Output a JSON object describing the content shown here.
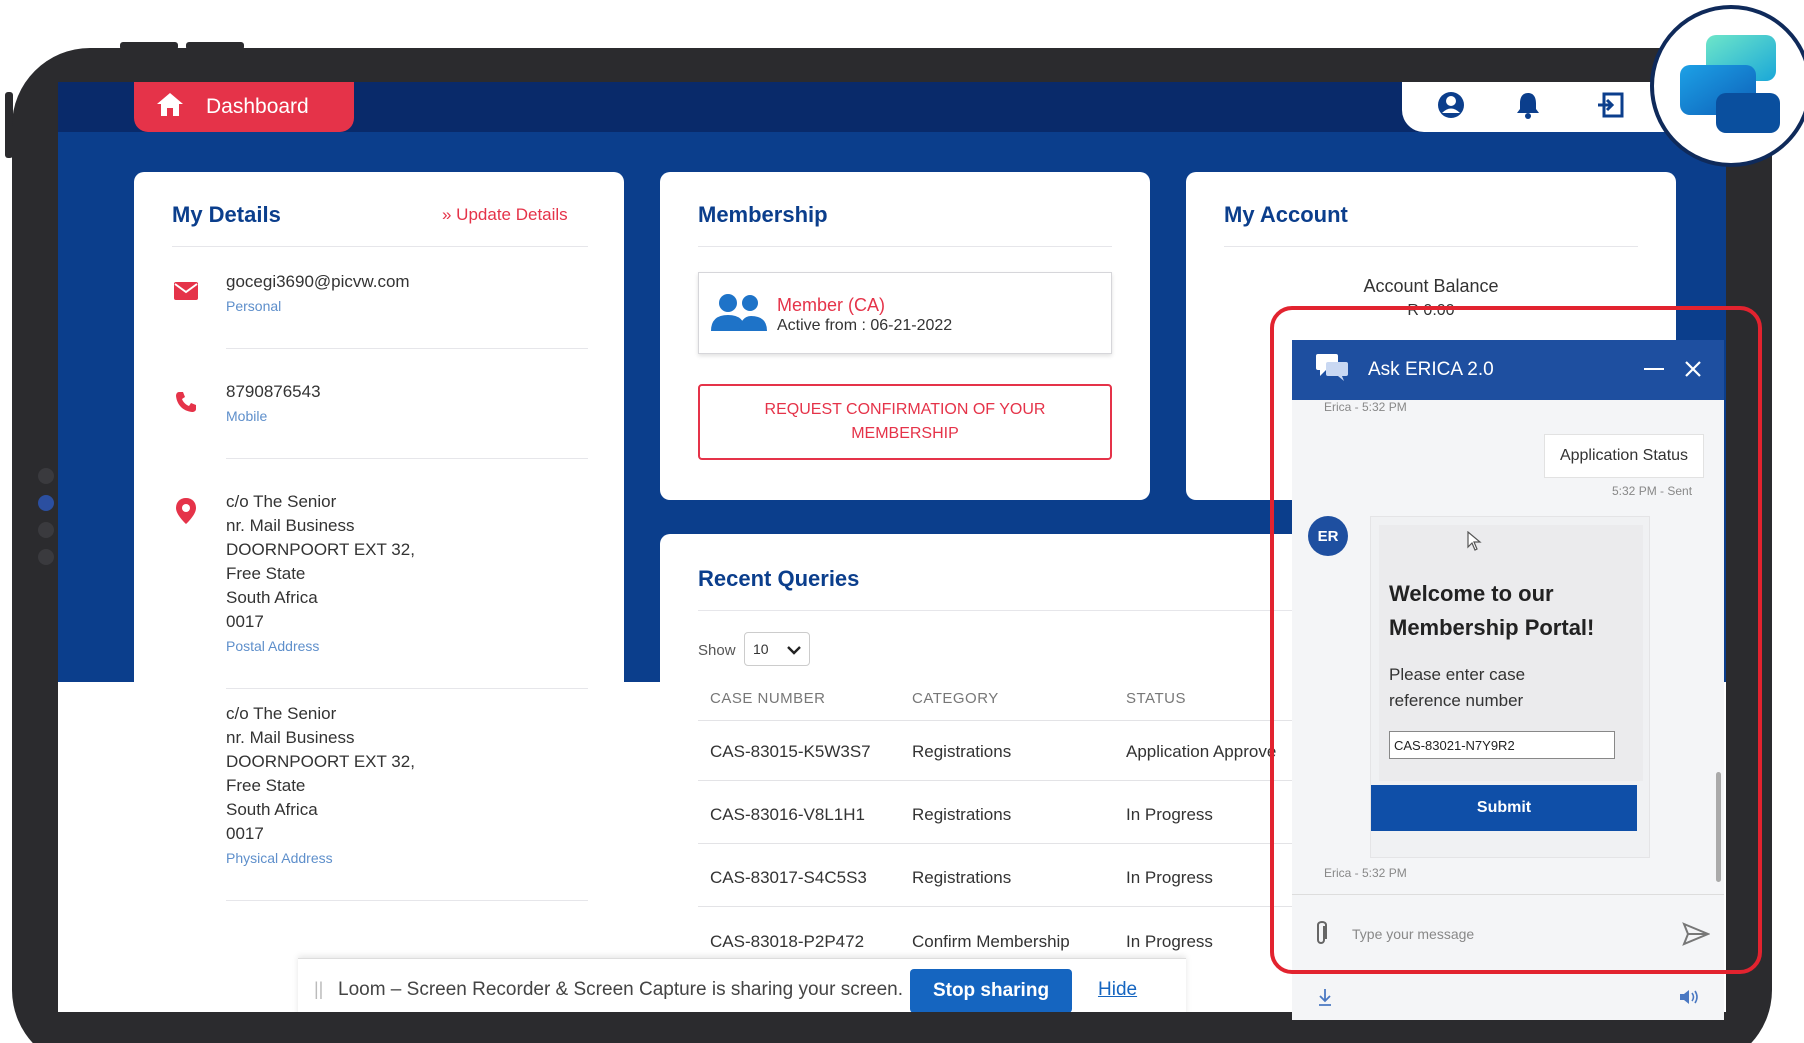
{
  "topbar": {
    "dashboard_label": "Dashboard"
  },
  "my_details": {
    "title": "My Details",
    "update_link": "» Update Details",
    "email": "gocegi3690@picvw.com",
    "email_label": "Personal",
    "phone": "8790876543",
    "phone_label": "Mobile",
    "postal": [
      "c/o The Senior",
      "nr. Mail Business",
      "DOORNPOORT EXT 32,",
      "Free State",
      "South Africa",
      "0017"
    ],
    "postal_label": "Postal Address",
    "physical": [
      "c/o The Senior",
      "nr. Mail Business",
      "DOORNPOORT EXT 32,",
      "Free State",
      "South Africa",
      "0017"
    ],
    "physical_label": "Physical Address"
  },
  "membership": {
    "title": "Membership",
    "member_type": "Member (CA)",
    "active_from": "Active from : 06-21-2022",
    "request_button_line1": "REQUEST CONFIRMATION OF YOUR",
    "request_button_line2": "MEMBERSHIP"
  },
  "my_account": {
    "title": "My Account",
    "balance_label": "Account Balance",
    "balance_value": "R 0.00"
  },
  "recent_queries": {
    "title": "Recent Queries",
    "show_label": "Show",
    "show_value": "10",
    "columns": [
      "CASE NUMBER",
      "CATEGORY",
      "STATUS"
    ],
    "rows": [
      {
        "case": "CAS-83015-K5W3S7",
        "category": "Registrations",
        "status": "Application Approve"
      },
      {
        "case": "CAS-83016-V8L1H1",
        "category": "Registrations",
        "status": "In Progress"
      },
      {
        "case": "CAS-83017-S4C5S3",
        "category": "Registrations",
        "status": "In Progress"
      },
      {
        "case": "CAS-83018-P2P472",
        "category": "Confirm Membership",
        "status": "In Progress"
      }
    ]
  },
  "loom": {
    "message": "Loom – Screen Recorder & Screen Capture is sharing your screen.",
    "stop_label": "Stop sharing",
    "hide_label": "Hide"
  },
  "chat": {
    "title": "Ask ERICA 2.0",
    "top_meta": "Erica - 5:32 PM",
    "user_message": "Application Status",
    "user_meta": "5:32 PM - Sent",
    "avatar_initials": "ER",
    "welcome_line1": "Welcome to our",
    "welcome_line2": "Membership Portal!",
    "prompt_line1": "Please enter case",
    "prompt_line2": "reference number",
    "input_value": "CAS-83021-N7Y9R2",
    "submit_label": "Submit",
    "bot_meta": "Erica - 5:32 PM",
    "composer_placeholder": "Type your message"
  },
  "colors": {
    "navy": "#0b3e8c",
    "accent_red": "#e53349",
    "chat_header": "#1e4fa0",
    "highlight": "#e2232f"
  }
}
